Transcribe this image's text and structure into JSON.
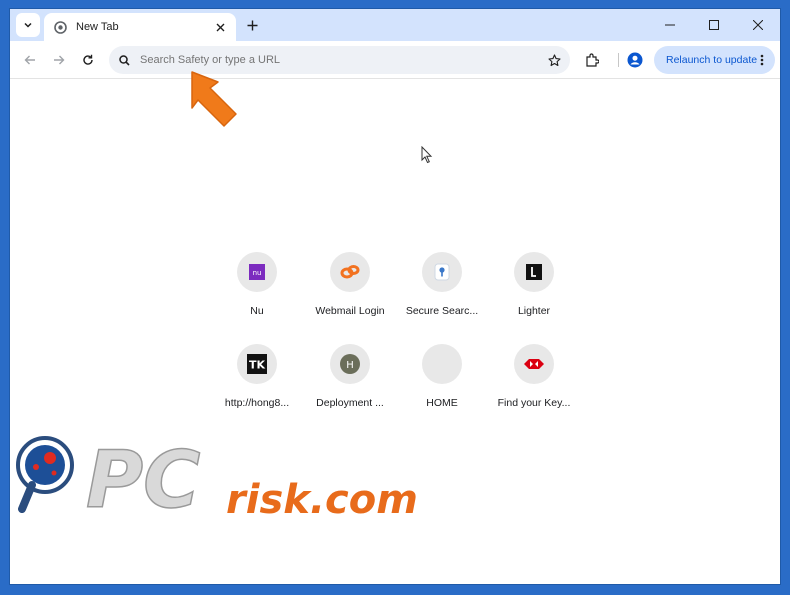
{
  "tab": {
    "title": "New Tab",
    "favicon": "chrome-icon"
  },
  "omnibox": {
    "placeholder": "Search Safety or type a URL"
  },
  "toolbar": {
    "relaunch_label": "Relaunch to update"
  },
  "shortcuts": [
    {
      "label": "Nu",
      "icon": "nu-icon"
    },
    {
      "label": "Webmail Login",
      "icon": "webmail-icon"
    },
    {
      "label": "Secure Searc...",
      "icon": "secure-search-icon"
    },
    {
      "label": "Lighter",
      "icon": "lighter-icon"
    },
    {
      "label": "http://hong8...",
      "icon": "tk-icon"
    },
    {
      "label": "Deployment ...",
      "icon": "h-icon"
    },
    {
      "label": "HOME",
      "icon": "blank-icon"
    },
    {
      "label": "Find your Key...",
      "icon": "key-icon"
    }
  ],
  "colors": {
    "tabstrip": "#d3e3fd",
    "accent": "#0b57d0",
    "annotation_arrow": "#f07a1a"
  },
  "watermark": {
    "text": "PCrisk.com"
  }
}
